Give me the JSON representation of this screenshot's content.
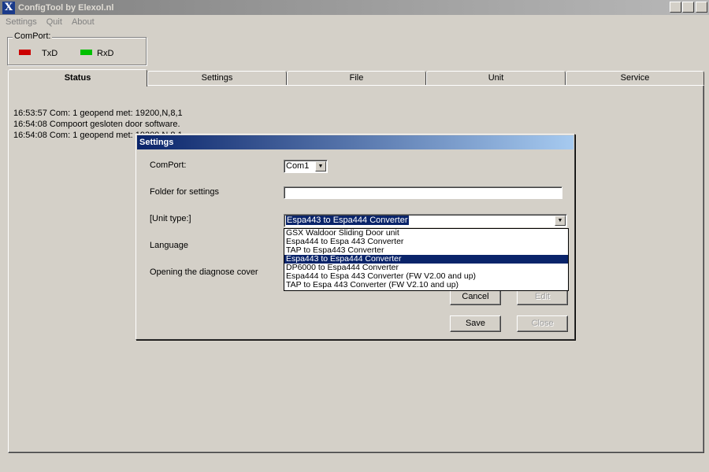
{
  "window": {
    "title": "ConfigTool by Elexol.nl",
    "icon_glyph": "X",
    "minimize_glyph": "_",
    "maximize_glyph": "□",
    "close_glyph": "×"
  },
  "menu": [
    "Settings",
    "Quit",
    "About"
  ],
  "comport_group": {
    "label": "ComPort:",
    "txd": {
      "label": "TxD",
      "color": "#cc0000"
    },
    "rxd": {
      "label": "RxD",
      "color": "#00c000"
    }
  },
  "tabs": [
    {
      "label": "Status",
      "active": true
    },
    {
      "label": "Settings",
      "active": false
    },
    {
      "label": "File",
      "active": false
    },
    {
      "label": "Unit",
      "active": false
    },
    {
      "label": "Service",
      "active": false
    }
  ],
  "log": [
    "16:53:57 Com: 1 geopend met: 19200,N,8,1",
    "16:54:08 Compoort gesloten door software.",
    "16:54:08 Com: 1 geopend met: 19200,N,8,1"
  ],
  "dialog": {
    "title": "Settings",
    "comport_label": "ComPort:",
    "comport_value": "Com1",
    "folder_label": "Folder for settings",
    "folder_value": "",
    "unit_type_label": "[Unit type:]",
    "unit_type_value": "Espa443 to Espa444 Converter",
    "language_label": "Language",
    "diagnose_label": "Opening the diagnose cover",
    "unit_type_options": [
      "GSX Waldoor Sliding Door unit",
      "Espa444 to Espa 443 Converter",
      "TAP to Espa443 Converter",
      "Espa443 to Espa444 Converter",
      "DP6000 to Espa444 Converter",
      "Espa444 to Espa 443 Converter (FW V2.00 and up)",
      "TAP to Espa 443 Converter (FW V2.10 and up)"
    ],
    "selected_option": "Espa443 to Espa444 Converter",
    "buttons": {
      "cancel": "Cancel",
      "edit": "Edit",
      "save": "Save",
      "close": "Close"
    },
    "colors": {
      "title_start": "#0a246a",
      "title_end": "#a6caf0",
      "selection": "#0a246a"
    }
  }
}
